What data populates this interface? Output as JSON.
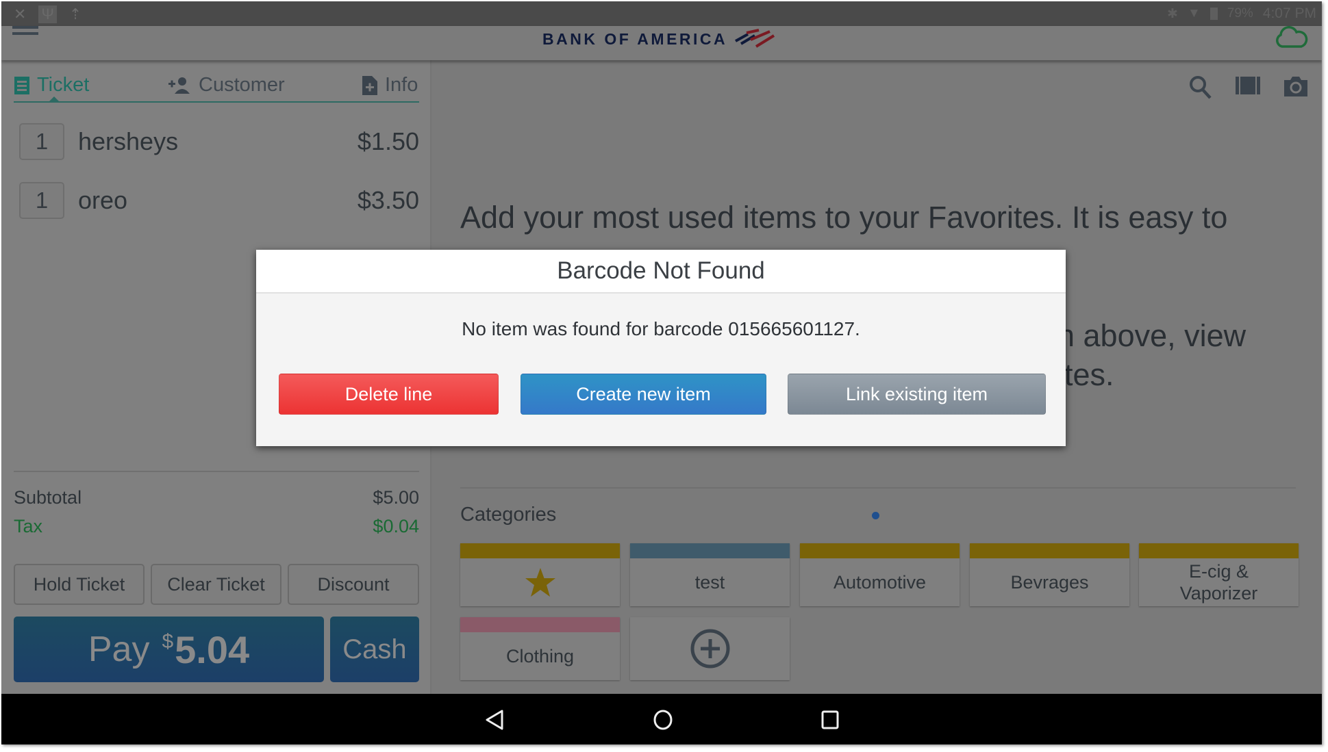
{
  "status_bar": {
    "left_icons": [
      "notification-muted-icon",
      "usb-icon",
      "upload-icon"
    ],
    "bluetooth": "bluetooth-icon",
    "wifi": "wifi-icon",
    "battery_icon": "battery-icon",
    "battery": "79%",
    "time": "4:07 PM"
  },
  "app_bar": {
    "menu_icon": "hamburger-menu-icon",
    "logo_text": "BANK OF AMERICA",
    "sync_icon": "cloud-sync-icon",
    "sync_color": "#1f6b3a"
  },
  "ticket_panel": {
    "tabs": [
      {
        "label": "Ticket",
        "icon": "receipt-icon",
        "active": true
      },
      {
        "label": "Customer",
        "icon": "add-person-icon",
        "active": false
      },
      {
        "label": "Info",
        "icon": "add-document-icon",
        "active": false
      }
    ],
    "line_items": [
      {
        "qty": "1",
        "name": "hersheys",
        "price": "$1.50"
      },
      {
        "qty": "1",
        "name": "oreo",
        "price": "$3.50"
      }
    ],
    "subtotal_label": "Subtotal",
    "subtotal_value": "$5.00",
    "tax_label": "Tax",
    "tax_value": "$0.04",
    "actions": [
      "Hold Ticket",
      "Clear Ticket",
      "Discount"
    ],
    "pay_label": "Pay",
    "pay_currency": "$",
    "pay_amount": "5.04",
    "cash_label": "Cash"
  },
  "main_panel": {
    "tool_icons": [
      "search-icon",
      "barcode-icon",
      "camera-icon"
    ],
    "favorites_line1": "Add your most used items to your Favorites. It is easy to",
    "favorites_line2_partial": "n above, view",
    "favorites_line3_partial": "ites.",
    "categories_label": "Categories",
    "categories": [
      {
        "label": "",
        "icon": "star-icon",
        "color": "#7a6308"
      },
      {
        "label": "test",
        "color": "#3f5b6b"
      },
      {
        "label": "Automotive",
        "color": "#7a6308"
      },
      {
        "label": "Bevrages",
        "color": "#7a6308"
      },
      {
        "label": "E-cig & Vaporizer",
        "color": "#7a6308"
      },
      {
        "label": "Clothing",
        "color": "#8a5a68"
      },
      {
        "label": "",
        "icon": "add-circle-icon",
        "color": ""
      }
    ]
  },
  "dialog": {
    "title": "Barcode Not Found",
    "message": "No item was found for barcode 015665601127.",
    "buttons": {
      "delete": "Delete line",
      "create": "Create new item",
      "link": "Link existing item"
    }
  },
  "nav_bar": {
    "back": "back-icon",
    "home": "home-icon",
    "recents": "recents-icon"
  }
}
